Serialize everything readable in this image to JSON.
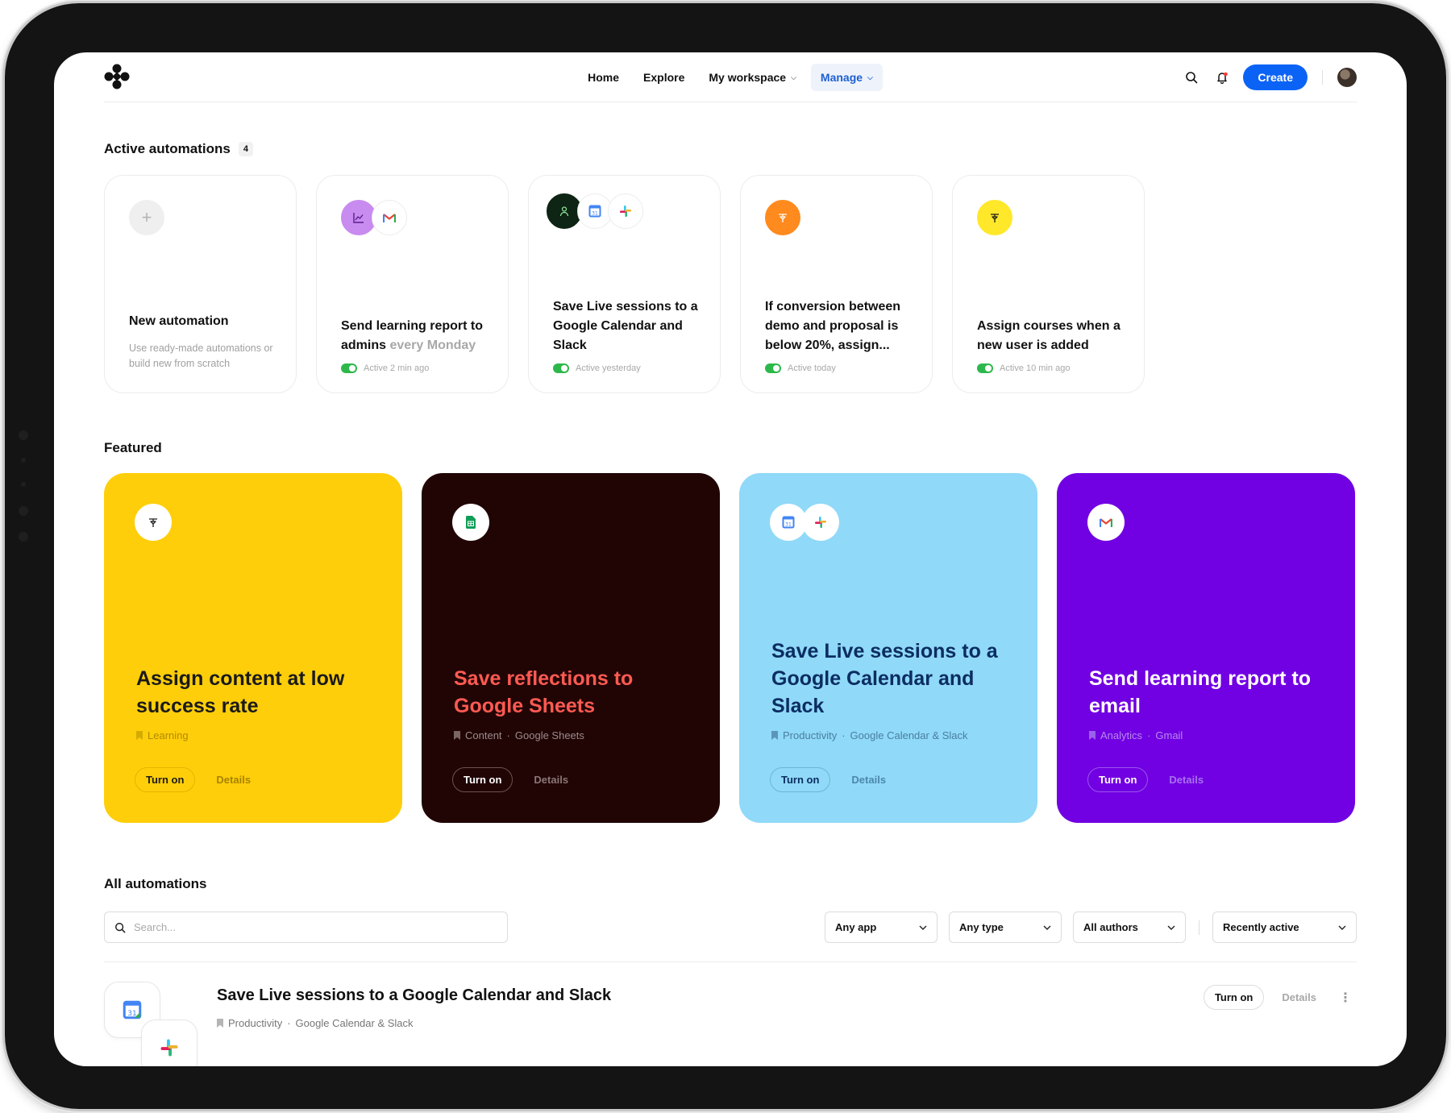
{
  "nav": {
    "items": [
      {
        "label": "Home"
      },
      {
        "label": "Explore"
      },
      {
        "label": "My workspace"
      },
      {
        "label": "Manage"
      }
    ],
    "create_label": "Create"
  },
  "active": {
    "title": "Active automations",
    "count": "4",
    "new_card": {
      "title": "New automation",
      "subtitle": "Use ready-made automations or build new from scratch"
    },
    "cards": [
      {
        "title": "Send learning report to admins",
        "title_muted": "every Monday",
        "status": "Active 2 min ago"
      },
      {
        "title": "Save Live sessions to a Google Calendar and Slack",
        "status": "Active yesterday"
      },
      {
        "title": "If conversion between demo and proposal is below 20%, assign...",
        "status": "Active today"
      },
      {
        "title": "Assign courses when a new user is added",
        "status": "Active 10 min ago"
      }
    ]
  },
  "featured": {
    "title": "Featured",
    "turn_on_label": "Turn on",
    "details_label": "Details",
    "cards": [
      {
        "title": "Assign content at low success rate",
        "category": "Learning",
        "apps": "",
        "bg": "#ffce0a",
        "title_color": "#1a1a1a"
      },
      {
        "title": "Save reflections to Google Sheets",
        "category": "Content",
        "apps": "Google Sheets",
        "bg": "#210505",
        "title_color": "#ff5a52"
      },
      {
        "title": "Save Live sessions to a Google Calendar and Slack",
        "category": "Productivity",
        "apps": "Google Calendar & Slack",
        "bg": "#90d9f8",
        "title_color": "#0b2d62"
      },
      {
        "title": "Send learning report to email",
        "category": "Analytics",
        "apps": "Gmail",
        "bg": "#7100e2",
        "title_color": "#ffffff"
      }
    ]
  },
  "all": {
    "title": "All automations",
    "search_placeholder": "Search...",
    "filters": [
      "Any app",
      "Any type",
      "All authors",
      "Recently active"
    ],
    "rows": [
      {
        "title": "Save Live sessions to a Google Calendar and Slack",
        "category": "Productivity",
        "apps": "Google Calendar & Slack",
        "turn_on": "Turn on",
        "details": "Details"
      }
    ]
  },
  "icons": {
    "calendar_day": "31",
    "gmail_letter": "M"
  },
  "colors": {
    "accent": "#0b63f6",
    "active_toggle": "#2db84b",
    "nav_active_bg": "#eef3fb",
    "nav_active_text": "#1d5fd3"
  }
}
